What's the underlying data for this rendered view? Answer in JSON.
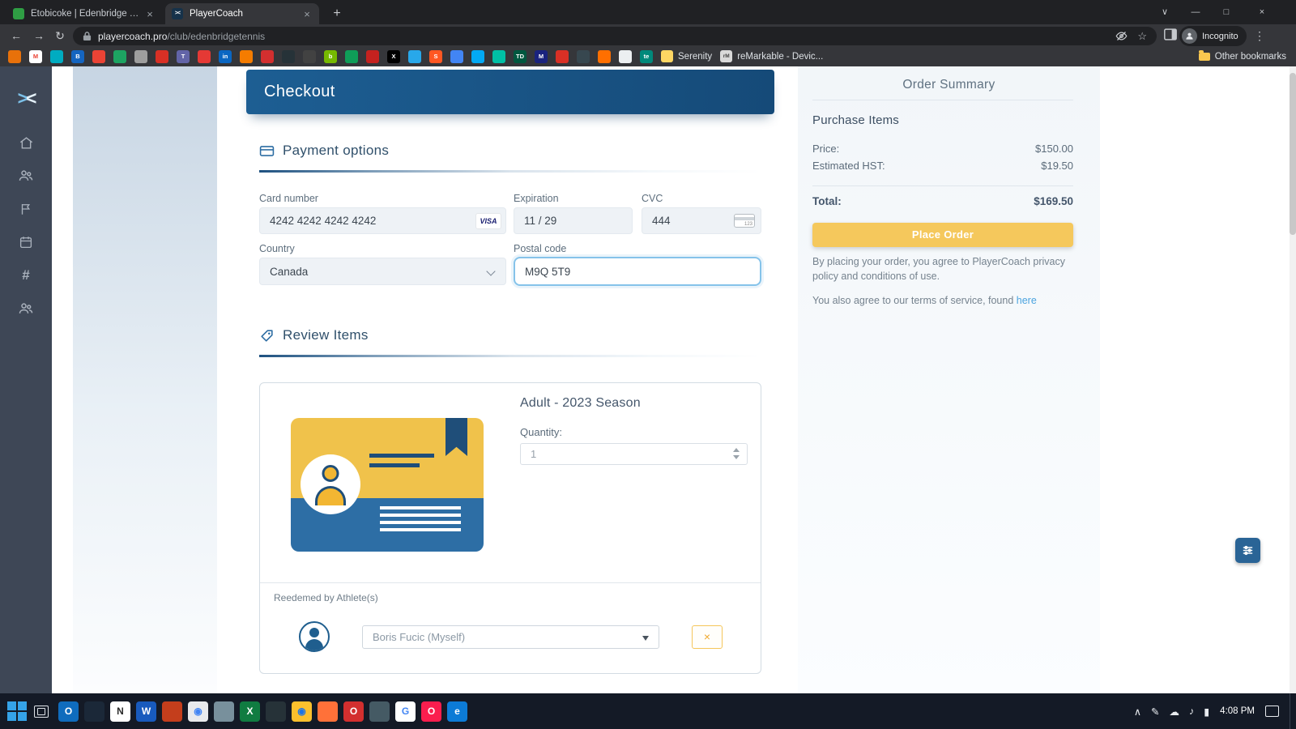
{
  "browser": {
    "tabs": [
      {
        "label": "Etobicoke | Edenbridge Tennis Cl"
      },
      {
        "label": "PlayerCoach"
      }
    ],
    "tab_close": "×",
    "playercoach_glyph": "><",
    "new_tab": "+",
    "window": {
      "tab_search": "∨",
      "minimize": "—",
      "maximize": "□",
      "close": "×"
    },
    "nav": {
      "back": "←",
      "forward": "→",
      "reload": "↻"
    },
    "url": {
      "domain": "playercoach.pro",
      "path": "/club/edenbridgetennis"
    },
    "star": "☆",
    "menu": "⋮",
    "incognito_label": "Incognito",
    "bookmarks": {
      "serenity": "Serenity",
      "remarkable": "reMarkable - Devic...",
      "remarkable_icon": "rM",
      "other": "Other bookmarks",
      "favicons": [
        {
          "c": "#e8710a",
          "g": ""
        },
        {
          "c": "#ffffff",
          "g": "M",
          "fg": "#ea4335"
        },
        {
          "c": "#00acc1",
          "g": ""
        },
        {
          "c": "#1565c0",
          "g": "B"
        },
        {
          "c": "#ea4335",
          "g": ""
        },
        {
          "c": "#1da462",
          "g": ""
        },
        {
          "c": "#9e9e9e",
          "g": ""
        },
        {
          "c": "#d93025",
          "g": ""
        },
        {
          "c": "#6264a7",
          "g": "T"
        },
        {
          "c": "#e53935",
          "g": ""
        },
        {
          "c": "#0a66c2",
          "g": "in"
        },
        {
          "c": "#f57c00",
          "g": ""
        },
        {
          "c": "#d32f2f",
          "g": ""
        },
        {
          "c": "#263238",
          "g": ""
        },
        {
          "c": "#424242",
          "g": ""
        },
        {
          "c": "#76b900",
          "g": "b"
        },
        {
          "c": "#0f9d58",
          "g": ""
        },
        {
          "c": "#c5221f",
          "g": ""
        },
        {
          "c": "#000000",
          "g": "X"
        },
        {
          "c": "#28a8ea",
          "g": ""
        },
        {
          "c": "#ff5722",
          "g": "S"
        },
        {
          "c": "#4285f4",
          "g": ""
        },
        {
          "c": "#03a9f4",
          "g": ""
        },
        {
          "c": "#00bfa5",
          "g": ""
        },
        {
          "c": "#00573f",
          "g": "TD"
        },
        {
          "c": "#1a237e",
          "g": "M"
        },
        {
          "c": "#d93025",
          "g": ""
        },
        {
          "c": "#37474f",
          "g": ""
        },
        {
          "c": "#ff6f00",
          "g": ""
        },
        {
          "c": "#eceff1",
          "g": ""
        },
        {
          "c": "#00897b",
          "g": "te"
        }
      ]
    }
  },
  "app": {
    "logo": {
      "left": ">",
      "right": "<"
    },
    "checkout_title": "Checkout",
    "payment": {
      "section_title": "Payment options",
      "card_number_label": "Card number",
      "card_number_value": "4242 4242 4242 4242",
      "visa": "VISA",
      "expiration_label": "Expiration",
      "expiration_value": "11 / 29",
      "cvc_label": "CVC",
      "cvc_value": "444",
      "country_label": "Country",
      "country_value": "Canada",
      "postal_label": "Postal code",
      "postal_value": "M9Q 5T9"
    },
    "review": {
      "section_title": "Review Items",
      "item_title": "Adult - 2023 Season",
      "quantity_label": "Quantity:",
      "quantity_value": "1",
      "redeemed_label": "Reedemed by Athlete(s)",
      "athlete_value": "Boris Fucic (Myself)",
      "remove_glyph": "×"
    },
    "summary": {
      "title": "Order Summary",
      "purchase_items": "Purchase Items",
      "price_label": "Price:",
      "price_value": "$150.00",
      "hst_label": "Estimated HST:",
      "hst_value": "$19.50",
      "total_label": "Total:",
      "total_value": "$169.50",
      "place_order": "Place Order",
      "legal1": "By placing your order, you agree to PlayerCoach privacy policy and conditions of use.",
      "legal2_text": "You also agree to our terms of service, found ",
      "legal2_link": "here"
    }
  },
  "taskbar": {
    "time": "4:08 PM",
    "apps": [
      {
        "name": "app-icon-outlook",
        "c": "#0f6cbd",
        "g": "O"
      },
      {
        "name": "app-icon",
        "c": "#1b2838",
        "g": ""
      },
      {
        "name": "app-icon-onenote",
        "c": "#ffffff",
        "g": "N",
        "fg": "#2b2b2b"
      },
      {
        "name": "app-icon-word",
        "c": "#185abd",
        "g": "W"
      },
      {
        "name": "app-icon",
        "c": "#c43e1c",
        "g": ""
      },
      {
        "name": "app-icon-chrome",
        "c": "#e8eaed",
        "g": "◉",
        "fg": "#4285f4"
      },
      {
        "name": "app-icon",
        "c": "#78909c",
        "g": ""
      },
      {
        "name": "app-icon-excel",
        "c": "#107c41",
        "g": "X"
      },
      {
        "name": "app-icon",
        "c": "#263238",
        "g": ""
      },
      {
        "name": "app-icon-chrome",
        "c": "#fbc02d",
        "g": "◉",
        "fg": "#1a73e8"
      },
      {
        "name": "app-icon-firefox",
        "c": "#ff7139",
        "g": ""
      },
      {
        "name": "app-icon",
        "c": "#d32f2f",
        "g": "O"
      },
      {
        "name": "app-icon",
        "c": "#455a64",
        "g": ""
      },
      {
        "name": "app-icon-google",
        "c": "#ffffff",
        "g": "G",
        "fg": "#4285f4"
      },
      {
        "name": "app-icon-opera",
        "c": "#fa1e4e",
        "g": "O"
      },
      {
        "name": "app-icon-edge",
        "c": "#0c7bd6",
        "g": "e"
      }
    ],
    "tray": [
      {
        "name": "tray-expand-icon",
        "g": "∧"
      },
      {
        "name": "tray-pen-icon",
        "g": "✎"
      },
      {
        "name": "tray-cloud-icon",
        "g": "☁"
      },
      {
        "name": "tray-volume-icon",
        "g": "♪"
      },
      {
        "name": "tray-battery-icon",
        "g": "▮"
      }
    ]
  }
}
